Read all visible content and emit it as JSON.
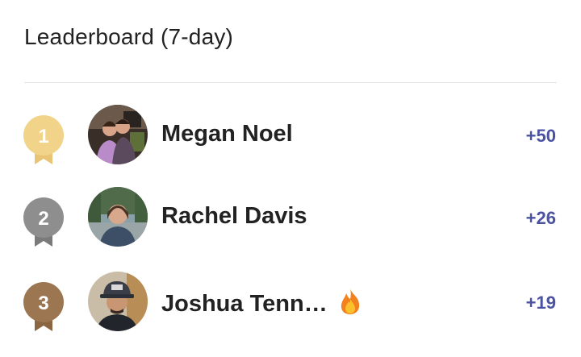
{
  "header": {
    "title": "Leaderboard (7-day)"
  },
  "colors": {
    "gold": "#F2D38A",
    "silver": "#8E8E8E",
    "bronze": "#9B7651",
    "score": "#4B53A0"
  },
  "leaders": [
    {
      "rank": "1",
      "medal": "gold",
      "name": "Megan Noel",
      "score": "+50",
      "badge": null
    },
    {
      "rank": "2",
      "medal": "silver",
      "name": "Rachel Davis",
      "score": "+26",
      "badge": null
    },
    {
      "rank": "3",
      "medal": "bronze",
      "name": "Joshua Tenn…",
      "score": "+19",
      "badge": "fire-icon"
    }
  ]
}
